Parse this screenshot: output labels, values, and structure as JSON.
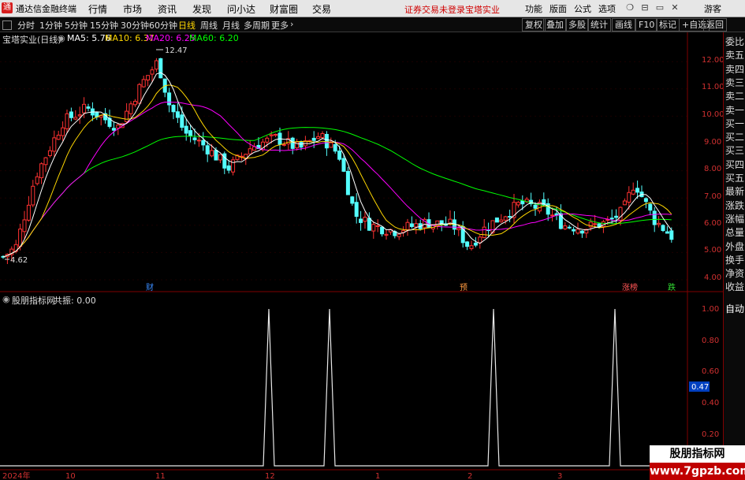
{
  "menubar": {
    "app_title": "通达信金融终端",
    "logo_char": "通",
    "items": [
      "行情",
      "市场",
      "资讯",
      "发现",
      "问小达",
      "财富圈",
      "交易"
    ],
    "warning": "证券交易未登录",
    "stock_name": "宝塔实业",
    "right_items": [
      "功能",
      "版面",
      "公式",
      "选项"
    ],
    "guest": "游客",
    "window_buttons": [
      "❍",
      "⊟",
      "▭",
      "✕"
    ]
  },
  "toolbar": {
    "periods": [
      "分时",
      "1分钟",
      "5分钟",
      "15分钟",
      "30分钟",
      "60分钟",
      "日线",
      "周线",
      "月线",
      "多周期",
      "更多"
    ],
    "active_period": "日线",
    "right_buttons": [
      "复权",
      "叠加",
      "多股",
      "统计",
      "画线",
      "F10",
      "标记",
      "+自选",
      "返回"
    ]
  },
  "main_panel": {
    "stock_title": "宝塔实业(日线)",
    "ma": [
      {
        "label": "MA5: 5.76",
        "color": "#ffffff"
      },
      {
        "label": "MA10: 6.37",
        "color": "#ffd700"
      },
      {
        "label": "MA20: 6.25",
        "color": "#ff00ff"
      },
      {
        "label": "MA60: 6.20",
        "color": "#00ff00"
      }
    ],
    "high_label": "12.47",
    "low_label": "4.62",
    "y_ticks": [
      "12.00",
      "11.00",
      "10.00",
      "9.00",
      "8.00",
      "7.00",
      "6.00",
      "5.00",
      "4.00"
    ],
    "markers": [
      {
        "text": "财",
        "color": "#3a8cff"
      },
      {
        "text": "预",
        "color": "#ff9a40"
      },
      {
        "text": "涨榜",
        "color": "#ff5555"
      },
      {
        "text": "跌",
        "color": "#33dd33"
      }
    ]
  },
  "indicator_panel": {
    "title": "股朋指标网",
    "value_label": "共振: 0.00",
    "y_ticks": [
      "1.00",
      "0.80",
      "0.60",
      "0.40",
      "0.20"
    ],
    "current_value": "0.47",
    "x_labels": [
      "2024年",
      "10",
      "11",
      "12",
      "1",
      "2",
      "3"
    ]
  },
  "side_panel": {
    "items": [
      "委比",
      "卖五",
      "卖四",
      "卖三",
      "卖二",
      "卖一",
      "买一",
      "买二",
      "买三",
      "买四",
      "买五",
      "最新",
      "涨跌",
      "涨幅",
      "总量",
      "外盘",
      "换手",
      "净资",
      "收益"
    ],
    "auto_label": "自动"
  },
  "watermark": {
    "line1": "股朋指标网",
    "line2": "www.7gpzb.com"
  },
  "colors": {
    "up": "#ff3232",
    "down": "#54ffff",
    "ma5": "#ffffff",
    "ma10": "#ffd700",
    "ma20": "#ff00ff",
    "ma60": "#00ff00",
    "axis_red": "#d03030"
  }
}
